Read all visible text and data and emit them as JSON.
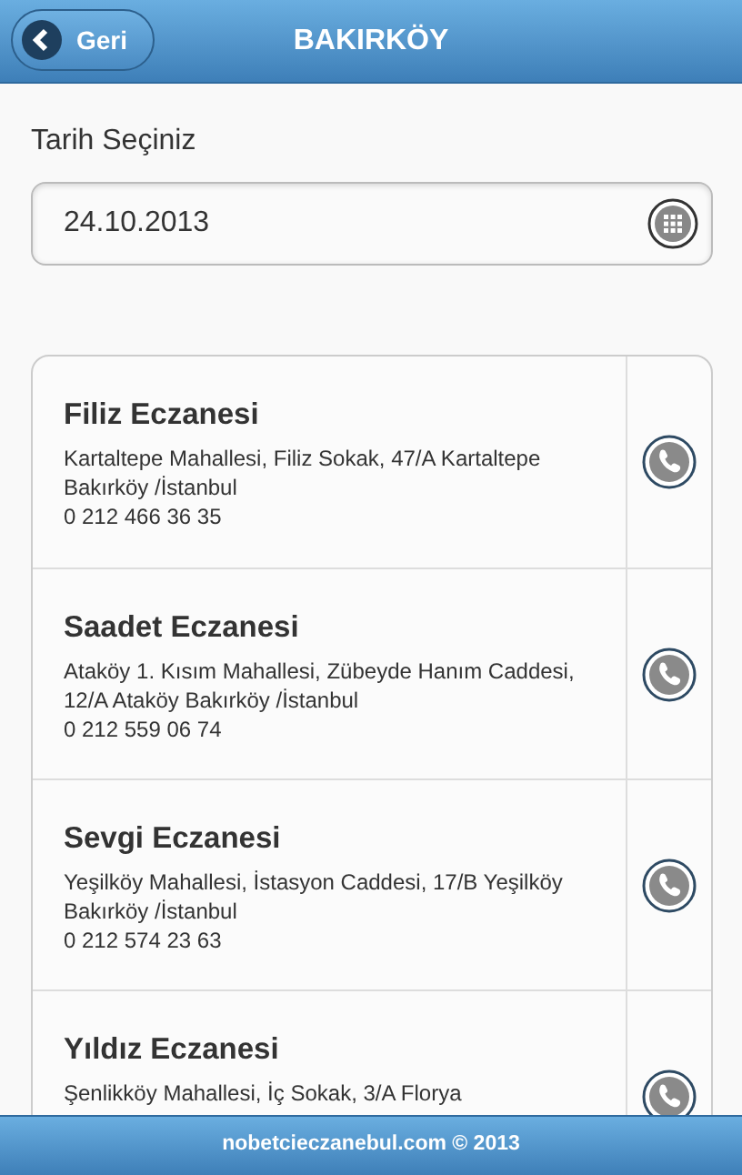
{
  "header": {
    "back_button": "Geri",
    "title": "BAKIRKÖY"
  },
  "date_picker": {
    "label": "Tarih Seçiniz",
    "value": "24.10.2013"
  },
  "pharmacies": [
    {
      "name": "Filiz Eczanesi",
      "address": "Kartaltepe Mahallesi, Filiz Sokak, 47/A Kartaltepe Bakırköy /İstanbul",
      "phone": "0 212 466 36 35"
    },
    {
      "name": "Saadet Eczanesi",
      "address": "Ataköy 1. Kısım Mahallesi, Zübeyde Hanım Caddesi, 12/A Ataköy Bakırköy /İstanbul",
      "phone": "0 212 559 06 74"
    },
    {
      "name": "Sevgi Eczanesi",
      "address": "Yeşilköy Mahallesi, İstasyon Caddesi, 17/B Yeşilköy Bakırköy /İstanbul",
      "phone": "0 212 574 23 63"
    },
    {
      "name": "Yıldız Eczanesi",
      "address": "Şenlikköy Mahallesi, İç Sokak, 3/A Florya"
    }
  ],
  "footer": "nobetcieczanebul.com © 2013"
}
